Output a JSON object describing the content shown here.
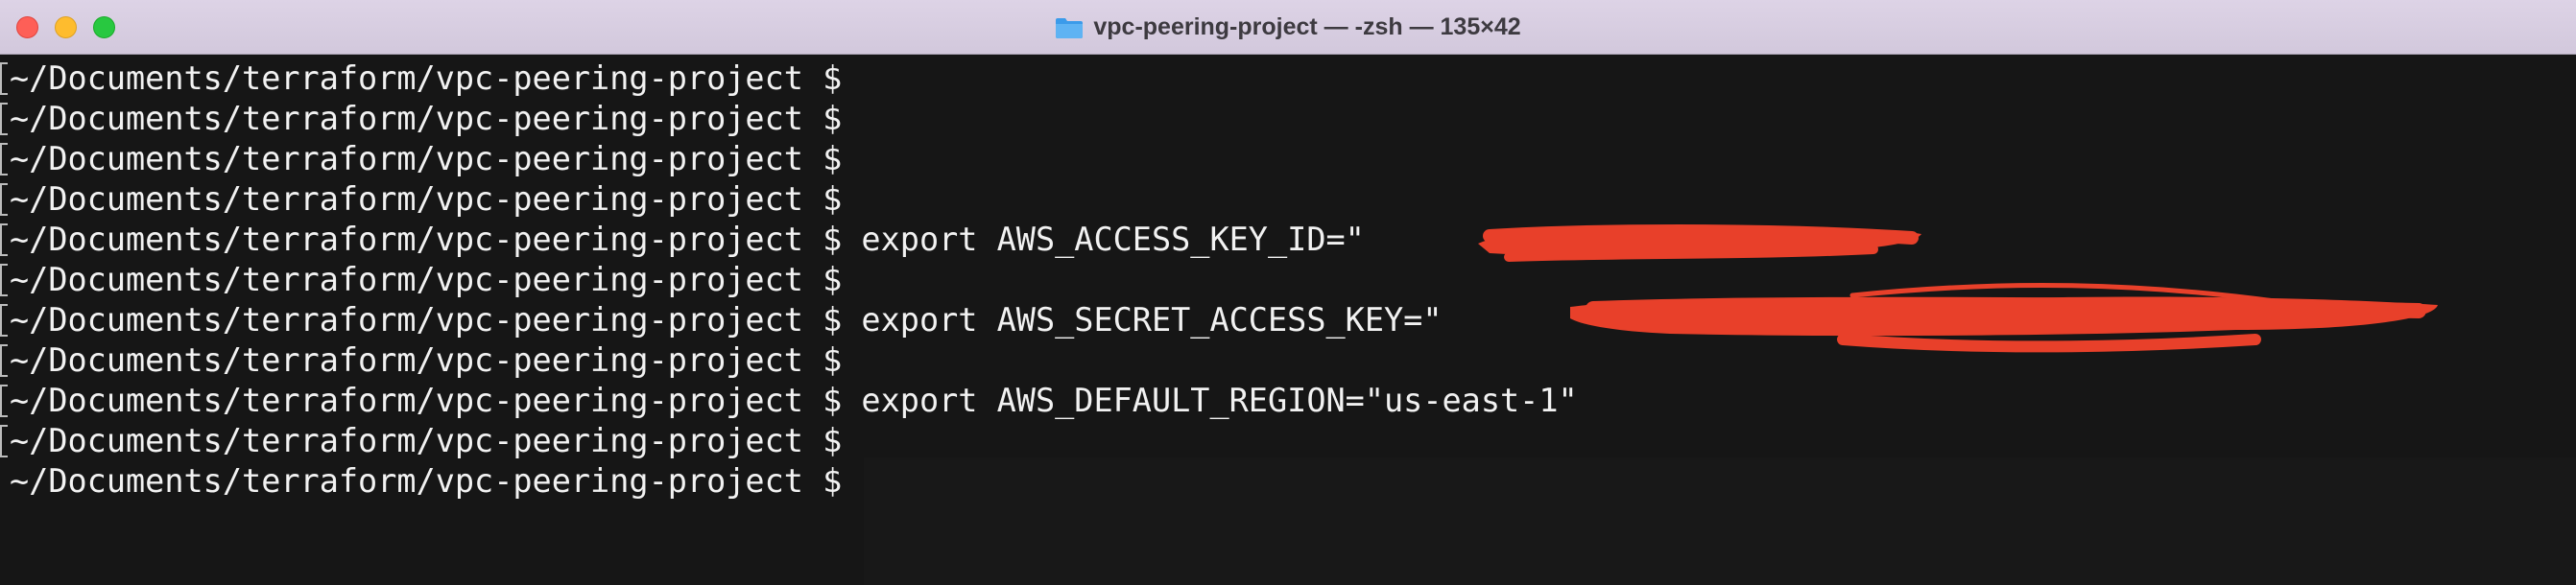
{
  "window": {
    "title": "vpc-peering-project — -zsh — 135×42",
    "title_icon": "folder-icon",
    "buttons": [
      "close-button",
      "minimize-button",
      "zoom-button"
    ]
  },
  "terminal": {
    "prompt": "~/Documents/terraform/vpc-peering-project $",
    "lines": [
      {
        "prompt": "~/Documents/terraform/vpc-peering-project $",
        "command": "",
        "marker": true
      },
      {
        "prompt": "~/Documents/terraform/vpc-peering-project $",
        "command": "",
        "marker": true
      },
      {
        "prompt": "~/Documents/terraform/vpc-peering-project $",
        "command": "",
        "marker": true
      },
      {
        "prompt": "~/Documents/terraform/vpc-peering-project $",
        "command": "",
        "marker": true
      },
      {
        "prompt": "~/Documents/terraform/vpc-peering-project $",
        "command": "export AWS_ACCESS_KEY_ID=\"",
        "marker": true,
        "redacted": true
      },
      {
        "prompt": "~/Documents/terraform/vpc-peering-project $",
        "command": "",
        "marker": true
      },
      {
        "prompt": "~/Documents/terraform/vpc-peering-project $",
        "command": "export AWS_SECRET_ACCESS_KEY=\"",
        "marker": true,
        "redacted": true
      },
      {
        "prompt": "~/Documents/terraform/vpc-peering-project $",
        "command": "",
        "marker": true
      },
      {
        "prompt": "~/Documents/terraform/vpc-peering-project $",
        "command": "export AWS_DEFAULT_REGION=\"us-east-1\"",
        "marker": true
      },
      {
        "prompt": "~/Documents/terraform/vpc-peering-project $",
        "command": "",
        "marker": true
      },
      {
        "prompt": "~/Documents/terraform/vpc-peering-project $",
        "command": "",
        "marker": false
      }
    ]
  },
  "colors": {
    "terminal_bg": "#161616",
    "text": "#f2f2f2",
    "titlebar": "#d8cee2",
    "redaction": "#e8402a"
  }
}
